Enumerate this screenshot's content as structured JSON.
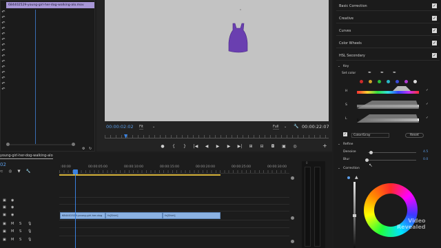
{
  "source": {
    "clip_name": "684402529-young-girl-her-dog-walking-alo.mov"
  },
  "program": {
    "timecode": "00:00:02:02",
    "fit": "Fit",
    "full": "Full",
    "duration": "00:00:22:07"
  },
  "timeline": {
    "sequence_name": "young-girl-her-dog-walking-alo",
    "timecode": "02",
    "ruler_labels": [
      ":00:00",
      "00:00:05:00",
      "00:00:10:00",
      "00:00:15:00",
      "00:00:20:00",
      "00:00:25:00",
      "00:00:30:00"
    ],
    "track_labels": [
      "V3",
      "V2",
      "V1",
      "A1",
      "A2",
      "A3"
    ],
    "clips": [
      "684402529-young-girl-her-dog",
      "fx[Shirt]",
      "fx[Shirt]"
    ],
    "meter_level": "0"
  },
  "lumetri": {
    "sections": [
      "Basic Correction",
      "Creative",
      "Curves",
      "Color Wheels",
      "HSL Secondary"
    ],
    "key_label": "Key",
    "set_color_label": "Set color",
    "hsl_rows": [
      "H",
      "S",
      "L"
    ],
    "color_gray_label": "Color/Gray",
    "reset_label": "Reset",
    "refine_label": "Refine",
    "denoise_label": "Denoise",
    "denoise_value": "4.5",
    "blur_label": "Blur",
    "blur_value": "0.0",
    "correction_label": "Correction"
  },
  "watermark": {
    "line1": "Video",
    "line2": "Revealed"
  },
  "colors": {
    "clip_label": "#a796d6",
    "video_clip": "#8cb3e4",
    "accent_blue": "#5b9de8",
    "inout_bar": "#d8b43a",
    "shirt": "#6a3fb0"
  }
}
